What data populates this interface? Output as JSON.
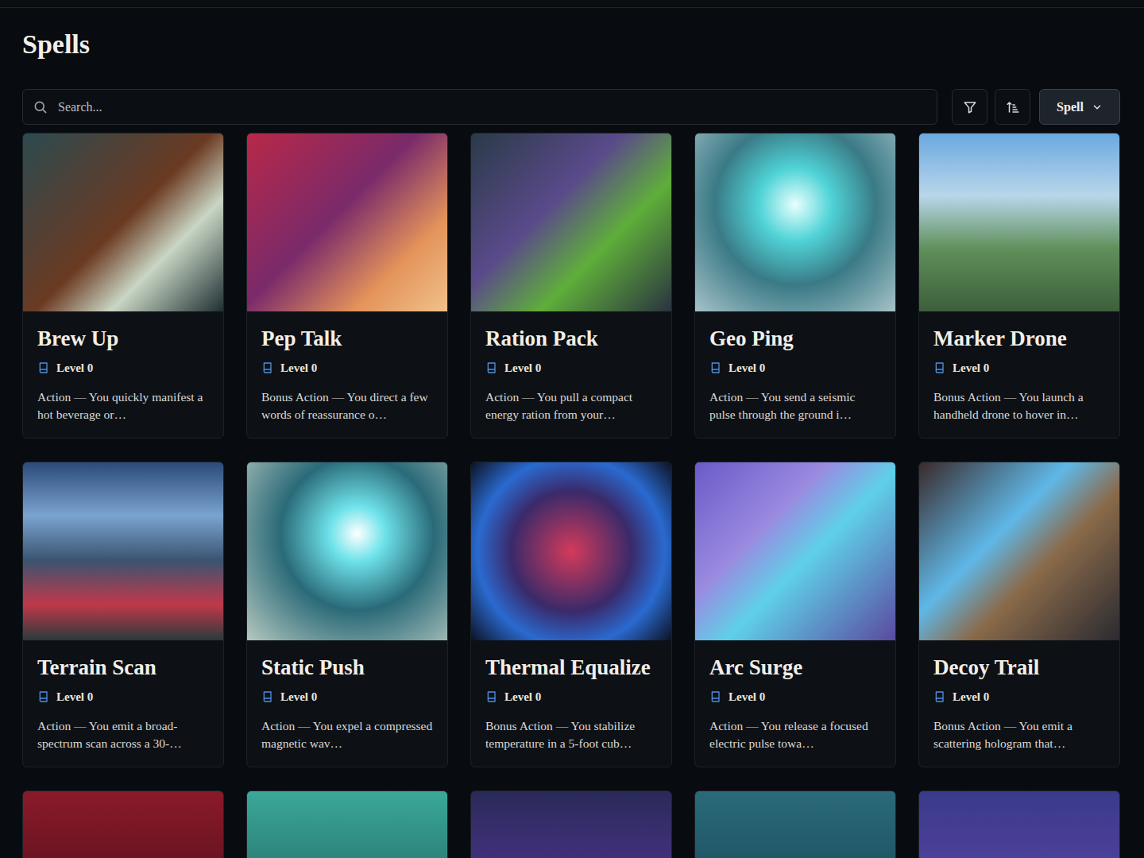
{
  "page": {
    "title": "Spells"
  },
  "search": {
    "placeholder": "Search..."
  },
  "type_select": {
    "value": "Spell",
    "expanded": false
  },
  "cards": [
    {
      "title": "Brew Up",
      "level": "Level 0",
      "description": "Action — You quickly manifest a hot beverage or…"
    },
    {
      "title": "Pep Talk",
      "level": "Level 0",
      "description": "Bonus Action — You direct a few words of reassurance o…"
    },
    {
      "title": "Ration Pack",
      "level": "Level 0",
      "description": "Action — You pull a compact energy ration from your…"
    },
    {
      "title": "Geo Ping",
      "level": "Level 0",
      "description": "Action — You send a seismic pulse through the ground i…"
    },
    {
      "title": "Marker Drone",
      "level": "Level 0",
      "description": "Bonus Action — You launch a handheld drone to hover in…"
    },
    {
      "title": "Terrain Scan",
      "level": "Level 0",
      "description": "Action — You emit a broad-spectrum scan across a 30-…"
    },
    {
      "title": "Static Push",
      "level": "Level 0",
      "description": "Action — You expel a compressed magnetic wav…"
    },
    {
      "title": "Thermal Equalize",
      "level": "Level 0",
      "description": "Bonus Action — You stabilize temperature in a 5-foot cub…"
    },
    {
      "title": "Arc Surge",
      "level": "Level 0",
      "description": "Action — You release a focused electric pulse towa…"
    },
    {
      "title": "Decoy Trail",
      "level": "Level 0",
      "description": "Bonus Action — You emit a scattering hologram that…"
    },
    {
      "title": "",
      "level": "",
      "description": ""
    },
    {
      "title": "",
      "level": "",
      "description": ""
    },
    {
      "title": "",
      "level": "",
      "description": ""
    },
    {
      "title": "",
      "level": "",
      "description": ""
    },
    {
      "title": "",
      "level": "",
      "description": ""
    }
  ]
}
